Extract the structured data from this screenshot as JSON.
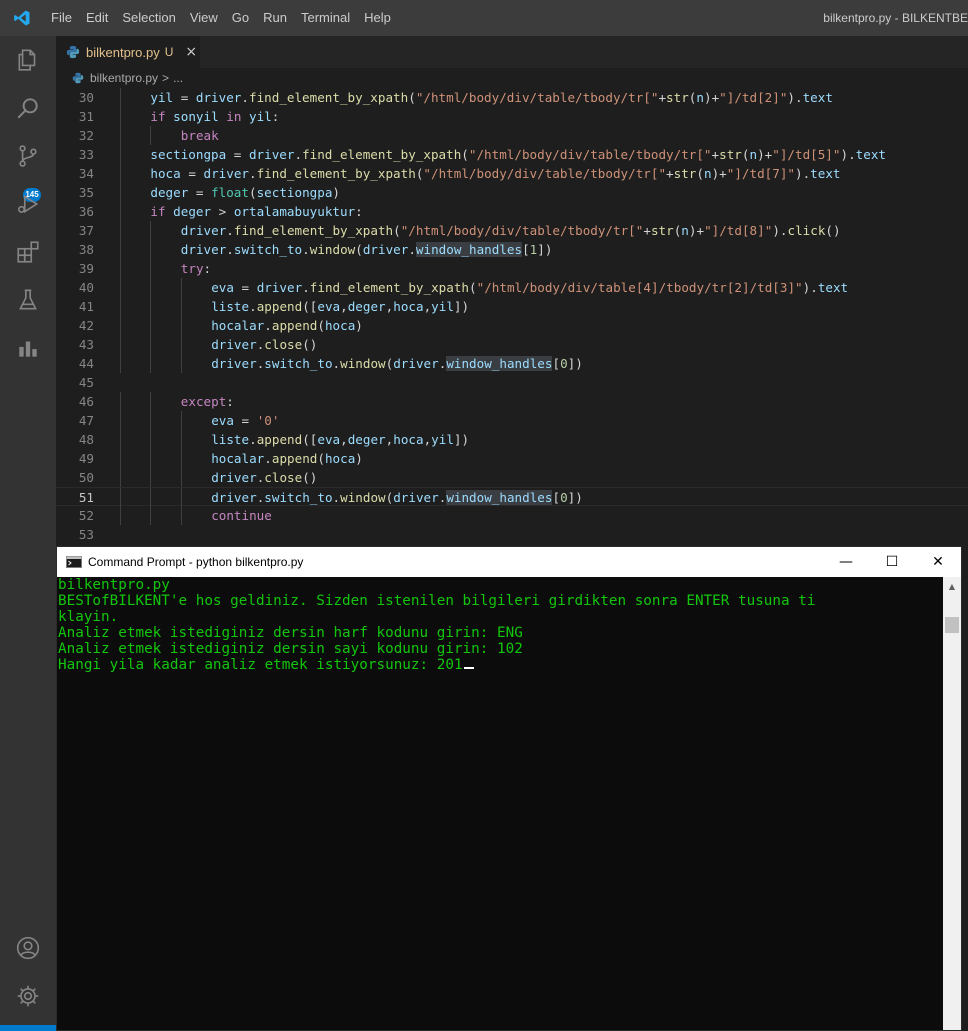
{
  "titlebar": {
    "menu": [
      "File",
      "Edit",
      "Selection",
      "View",
      "Go",
      "Run",
      "Terminal",
      "Help"
    ],
    "window_title": "bilkentpro.py - BILKENTBE"
  },
  "activity": {
    "icons": [
      "explorer-icon",
      "search-icon",
      "source-control-icon",
      "run-debug-icon",
      "extensions-icon",
      "testing-icon",
      "chart-icon",
      "account-icon",
      "settings-gear-icon"
    ],
    "source_control_badge": "145"
  },
  "tab": {
    "label": "bilkentpro.py",
    "status": "U",
    "close": "×"
  },
  "breadcrumb": {
    "file": "bilkentpro.py",
    "separator": ">",
    "more": "..."
  },
  "editor": {
    "lines": [
      {
        "n": "30",
        "indent": 1,
        "html": "<span class=\"v\">yil</span> = <span class=\"v\">driver</span>.<span class=\"f\">find_element_by_xpath</span>(<span class=\"s\">\"/html/body/div/table/tbody/tr[\"</span>+<span class=\"f\">str</span>(<span class=\"v\">n</span>)+<span class=\"s\">\"]/td[2]\"</span>).<span class=\"v\">text</span>"
      },
      {
        "n": "31",
        "indent": 1,
        "html": "<span class=\"k\">if</span> <span class=\"v\">sonyil</span> <span class=\"k\">in</span> <span class=\"v\">yil</span>:"
      },
      {
        "n": "32",
        "indent": 2,
        "html": "<span class=\"k\">break</span>"
      },
      {
        "n": "33",
        "indent": 1,
        "html": "<span class=\"v\">sectiongpa</span> = <span class=\"v\">driver</span>.<span class=\"f\">find_element_by_xpath</span>(<span class=\"s\">\"/html/body/div/table/tbody/tr[\"</span>+<span class=\"f\">str</span>(<span class=\"v\">n</span>)+<span class=\"s\">\"]/td[5]\"</span>).<span class=\"v\">text</span>"
      },
      {
        "n": "34",
        "indent": 1,
        "html": "<span class=\"v\">hoca</span> = <span class=\"v\">driver</span>.<span class=\"f\">find_element_by_xpath</span>(<span class=\"s\">\"/html/body/div/table/tbody/tr[\"</span>+<span class=\"f\">str</span>(<span class=\"v\">n</span>)+<span class=\"s\">\"]/td[7]\"</span>).<span class=\"v\">text</span>"
      },
      {
        "n": "35",
        "indent": 1,
        "html": "<span class=\"v\">deger</span> = <span class=\"c\">float</span>(<span class=\"v\">sectiongpa</span>)"
      },
      {
        "n": "36",
        "indent": 1,
        "html": "<span class=\"k\">if</span> <span class=\"v\">deger</span> &gt; <span class=\"v\">ortalamabuyuktur</span>:"
      },
      {
        "n": "37",
        "indent": 2,
        "html": "<span class=\"v\">driver</span>.<span class=\"f\">find_element_by_xpath</span>(<span class=\"s\">\"/html/body/div/table/tbody/tr[\"</span>+<span class=\"f\">str</span>(<span class=\"v\">n</span>)+<span class=\"s\">\"]/td[8]\"</span>).<span class=\"f\">click</span>()"
      },
      {
        "n": "38",
        "indent": 2,
        "html": "<span class=\"v\">driver</span>.<span class=\"v\">switch_to</span>.<span class=\"f\">window</span>(<span class=\"v\">driver</span>.<span class=\"v hl\">window_handles</span>[<span class=\"num\">1</span>])"
      },
      {
        "n": "39",
        "indent": 2,
        "html": "<span class=\"k\">try</span>:"
      },
      {
        "n": "40",
        "indent": 3,
        "html": "<span class=\"v\">eva</span> = <span class=\"v\">driver</span>.<span class=\"f\">find_element_by_xpath</span>(<span class=\"s\">\"/html/body/div/table[4]/tbody/tr[2]/td[3]\"</span>).<span class=\"v\">text</span>"
      },
      {
        "n": "41",
        "indent": 3,
        "html": "<span class=\"v\">liste</span>.<span class=\"f\">append</span>([<span class=\"v\">eva</span>,<span class=\"v\">deger</span>,<span class=\"v\">hoca</span>,<span class=\"v\">yil</span>])"
      },
      {
        "n": "42",
        "indent": 3,
        "html": "<span class=\"v\">hocalar</span>.<span class=\"f\">append</span>(<span class=\"v\">hoca</span>)"
      },
      {
        "n": "43",
        "indent": 3,
        "html": "<span class=\"v\">driver</span>.<span class=\"f\">close</span>()"
      },
      {
        "n": "44",
        "indent": 3,
        "html": "<span class=\"v\">driver</span>.<span class=\"v\">switch_to</span>.<span class=\"f\">window</span>(<span class=\"v\">driver</span>.<span class=\"v hl\">window_handles</span>[<span class=\"num\">0</span>])"
      },
      {
        "n": "45",
        "indent": 0,
        "html": ""
      },
      {
        "n": "46",
        "indent": 2,
        "html": "<span class=\"k\">except</span>:"
      },
      {
        "n": "47",
        "indent": 3,
        "html": "<span class=\"v\">eva</span> = <span class=\"s\">'0'</span>"
      },
      {
        "n": "48",
        "indent": 3,
        "html": "<span class=\"v\">liste</span>.<span class=\"f\">append</span>([<span class=\"v\">eva</span>,<span class=\"v\">deger</span>,<span class=\"v\">hoca</span>,<span class=\"v\">yil</span>])"
      },
      {
        "n": "49",
        "indent": 3,
        "html": "<span class=\"v\">hocalar</span>.<span class=\"f\">append</span>(<span class=\"v\">hoca</span>)"
      },
      {
        "n": "50",
        "indent": 3,
        "html": "<span class=\"v\">driver</span>.<span class=\"f\">close</span>()"
      },
      {
        "n": "51",
        "indent": 3,
        "html": "<span class=\"v\">driver</span>.<span class=\"v\">switch_to</span>.<span class=\"f\">window</span>(<span class=\"v\">driver</span>.<span class=\"v hl\">window_handles</span>[<span class=\"num\">0</span>])"
      },
      {
        "n": "52",
        "indent": 3,
        "html": "<span class=\"k\">continue</span>"
      },
      {
        "n": "53",
        "indent": 0,
        "html": ""
      }
    ],
    "current_line": "51"
  },
  "cmd": {
    "title": "Command Prompt - python  bilkentpro.py",
    "minimize": "—",
    "maximize": "☐",
    "close": "✕",
    "output": [
      "bilkentpro.py",
      "BESTofBILKENT'e hos geldiniz. Sizden istenilen bilgileri girdikten sonra ENTER tusuna ti",
      "klayin.",
      "Analiz etmek istediginiz dersin harf kodunu girin: ENG",
      "Analiz etmek istediginiz dersin sayi kodunu girin: 102"
    ],
    "prompt_line": "Hangi yila kadar analiz etmek istiyorsunuz: 201"
  },
  "colors": {
    "keyword": "#c586c0",
    "variable": "#9cdcfe",
    "function": "#dcdcaa",
    "string": "#ce9178",
    "builtin_class": "#4ec9b0",
    "number": "#b5cea8",
    "terminal_text": "#13c60d",
    "accent": "#007acc"
  }
}
